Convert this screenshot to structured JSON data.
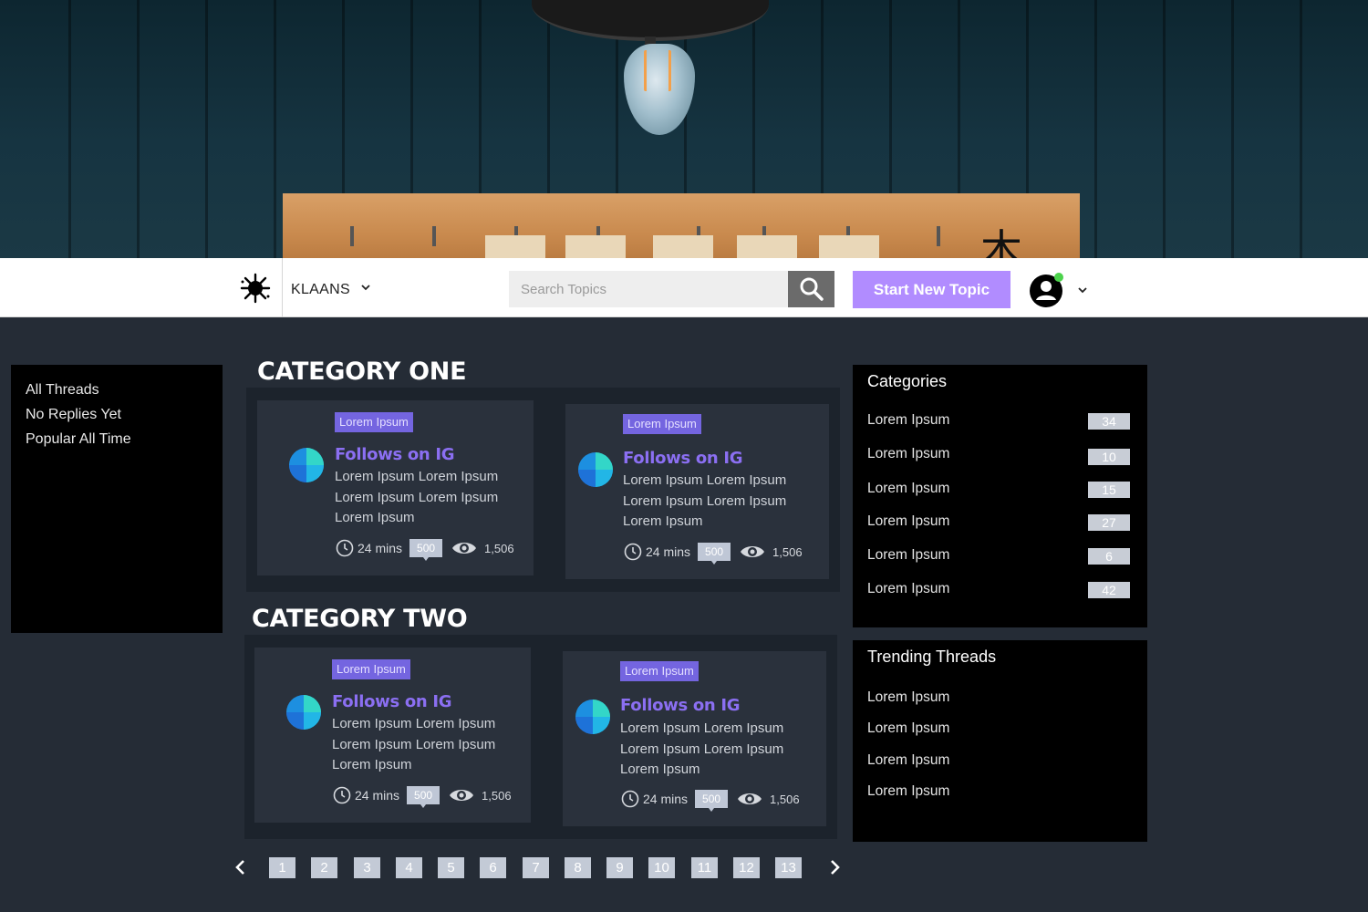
{
  "navbar": {
    "brand": "KLAANS",
    "search_placeholder": "Search Topics",
    "start_button": "Start New Topic",
    "icons": [
      "splat-logo-icon",
      "chevron-down-icon",
      "search-icon",
      "user-avatar-icon"
    ],
    "online_status_color": "#4cd34c"
  },
  "left_sidebar": {
    "items": [
      {
        "label": "All Threads"
      },
      {
        "label": "No Replies Yet"
      },
      {
        "label": "Popular All Time"
      }
    ]
  },
  "categories": [
    {
      "title": "CATEGORY ONE",
      "cards": [
        {
          "tag": "Lorem Ipsum",
          "title": "Follows on IG",
          "body": "Lorem Ipsum Lorem Ipsum Lorem Ipsum Lorem Ipsum Lorem Ipsum",
          "time": "24 mins",
          "replies": "500",
          "views": "1,506"
        },
        {
          "tag": "Lorem Ipsum",
          "title": "Follows on IG",
          "body": "Lorem Ipsum Lorem Ipsum Lorem Ipsum Lorem Ipsum Lorem Ipsum",
          "time": "24 mins",
          "replies": "500",
          "views": "1,506"
        }
      ]
    },
    {
      "title": "CATEGORY TWO",
      "cards": [
        {
          "tag": "Lorem Ipsum",
          "title": "Follows on IG",
          "body": "Lorem Ipsum Lorem Ipsum Lorem Ipsum Lorem Ipsum Lorem Ipsum",
          "time": "24 mins",
          "replies": "500",
          "views": "1,506"
        },
        {
          "tag": "Lorem Ipsum",
          "title": "Follows on IG",
          "body": "Lorem Ipsum Lorem Ipsum Lorem Ipsum Lorem Ipsum Lorem Ipsum",
          "time": "24 mins",
          "replies": "500",
          "views": "1,506"
        }
      ]
    }
  ],
  "right_sidebar": {
    "categories": {
      "title": "Categories",
      "items": [
        {
          "label": "Lorem Ipsum",
          "count": "34"
        },
        {
          "label": "Lorem Ipsum",
          "count": "10"
        },
        {
          "label": "Lorem Ipsum",
          "count": "15"
        },
        {
          "label": "Lorem Ipsum",
          "count": "27"
        },
        {
          "label": "Lorem Ipsum",
          "count": "6"
        },
        {
          "label": "Lorem Ipsum",
          "count": "42"
        }
      ]
    },
    "trending": {
      "title": "Trending Threads",
      "items": [
        {
          "label": "Lorem Ipsum"
        },
        {
          "label": "Lorem Ipsum"
        },
        {
          "label": "Lorem Ipsum"
        },
        {
          "label": "Lorem Ipsum"
        }
      ]
    }
  },
  "pagination": {
    "pages": [
      "1",
      "2",
      "3",
      "4",
      "5",
      "6",
      "7",
      "8",
      "9",
      "10",
      "11",
      "12",
      "13"
    ],
    "icons": [
      "chevron-left-icon",
      "chevron-right-icon"
    ]
  },
  "colors": {
    "accent": "#b18cff",
    "card_title": "#8b6ff2",
    "tag_bg": "#7465e0",
    "page_bg": "#252c36"
  }
}
